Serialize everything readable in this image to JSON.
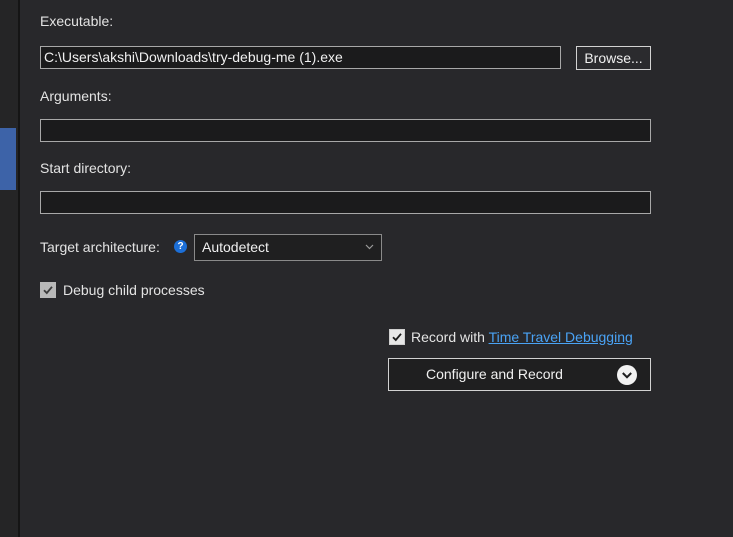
{
  "executable": {
    "label": "Executable:",
    "value": "C:\\Users\\akshi\\Downloads\\try-debug-me (1).exe",
    "browse_label": "Browse..."
  },
  "arguments": {
    "label": "Arguments:",
    "value": ""
  },
  "start_directory": {
    "label": "Start directory:",
    "value": ""
  },
  "target_architecture": {
    "label": "Target architecture:",
    "help_glyph": "?",
    "selected": "Autodetect"
  },
  "debug_child": {
    "label": "Debug child processes",
    "checked": true
  },
  "record": {
    "prefix": "Record with ",
    "link_text": "Time Travel Debugging",
    "checked": true
  },
  "configure_button": {
    "label": "Configure and Record",
    "icon": "chevron-down-circle-icon"
  },
  "colors": {
    "background": "#28282b",
    "field_background": "#1b1b1c",
    "accent_blue": "#3d63a8",
    "link": "#4aa3f5",
    "help_icon": "#1c6fd8"
  }
}
